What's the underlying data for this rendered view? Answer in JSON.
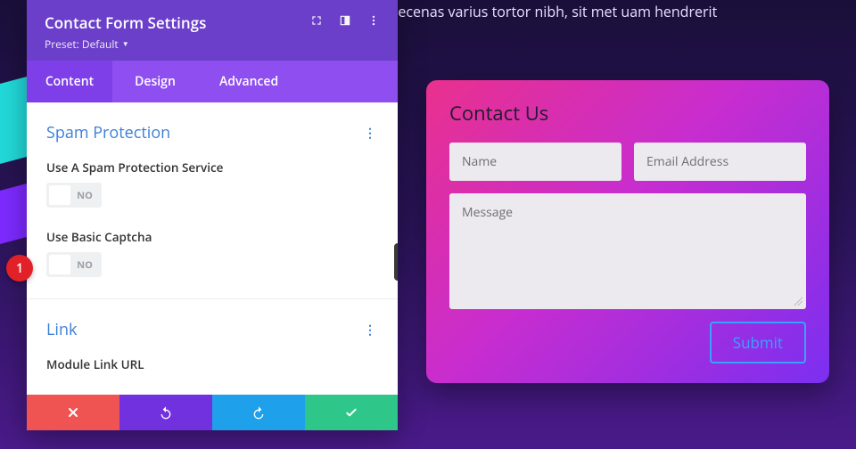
{
  "lorem": "m ipsum dolor sit amet, consectetur adipiscing elit. Maecenas varius tortor nibh, sit\nmet                                                                                                 uam hendrerit",
  "badge": "1",
  "panel": {
    "title": "Contact Form Settings",
    "preset_label": "Preset: Default",
    "tabs": {
      "content": "Content",
      "design": "Design",
      "advanced": "Advanced"
    },
    "sections": {
      "spam": {
        "title": "Spam Protection",
        "opt1_label": "Use A Spam Protection Service",
        "opt1_state": "NO",
        "opt2_label": "Use Basic Captcha",
        "opt2_state": "NO"
      },
      "link": {
        "title": "Link",
        "opt1_label": "Module Link URL"
      }
    }
  },
  "form": {
    "title": "Contact Us",
    "name_placeholder": "Name",
    "email_placeholder": "Email Address",
    "message_placeholder": "Message",
    "submit_label": "Submit"
  }
}
